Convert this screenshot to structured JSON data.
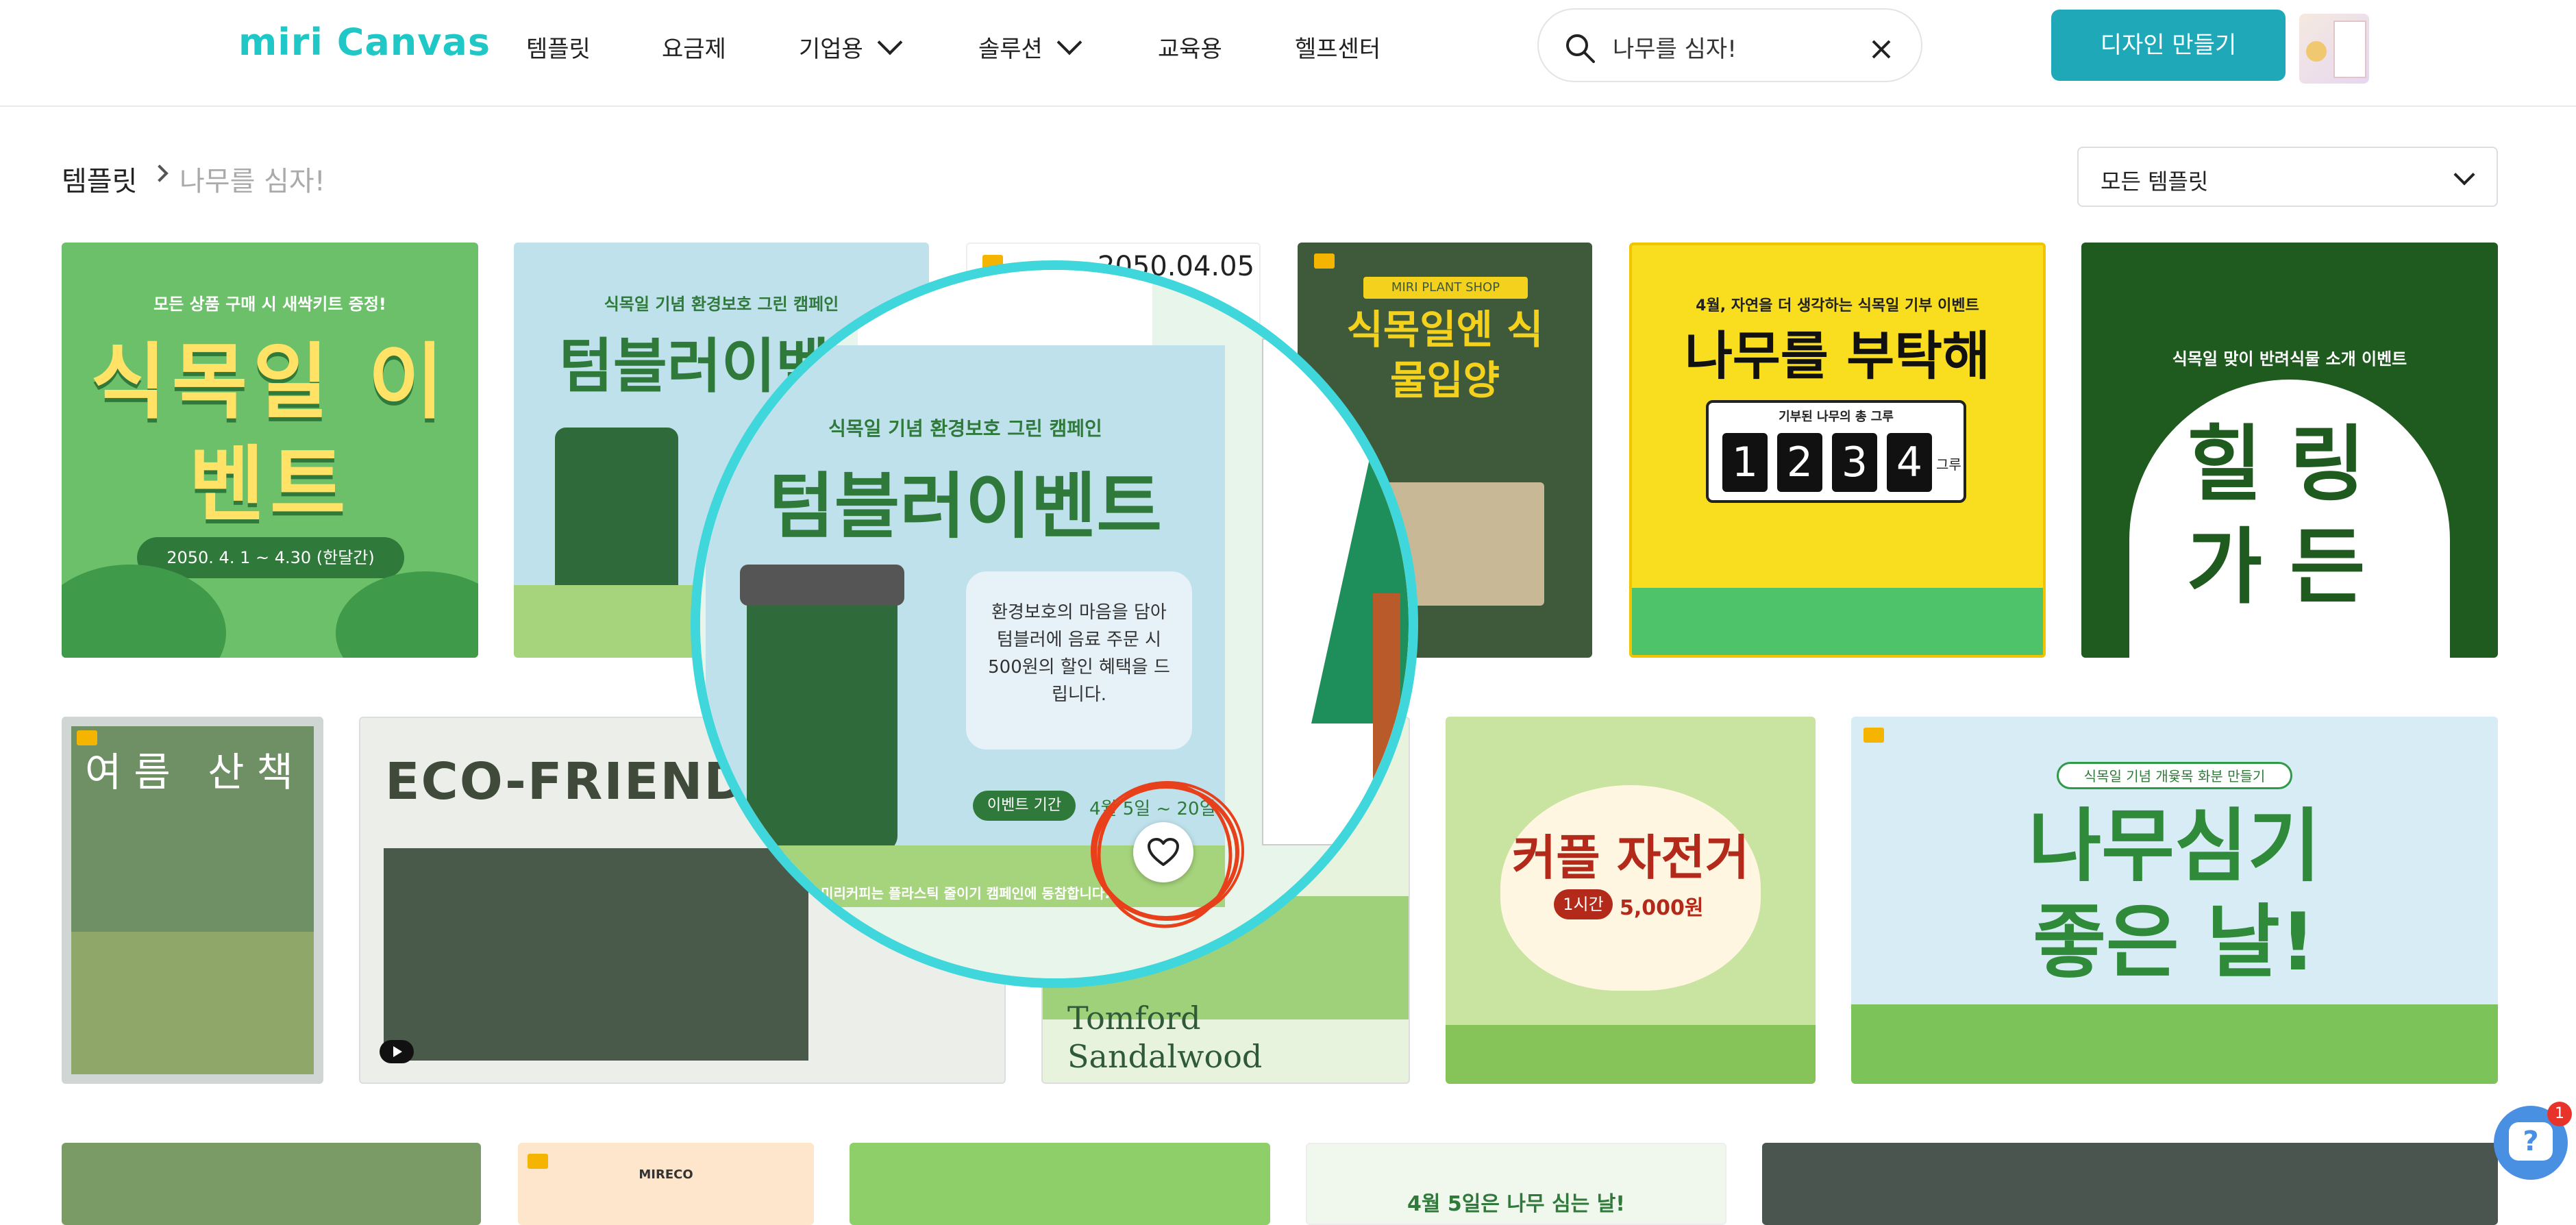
{
  "header": {
    "logo": "miri Canvas",
    "nav": [
      {
        "label": "템플릿"
      },
      {
        "label": "요금제"
      },
      {
        "label": "기업용",
        "has_dropdown": true
      },
      {
        "label": "솔루션",
        "has_dropdown": true
      },
      {
        "label": "교육용"
      },
      {
        "label": "헬프센터"
      }
    ],
    "search_value": "나무를 심자!",
    "make_button": "디자인 만들기"
  },
  "breadcrumb": {
    "root": "템플릿",
    "current": "나무를 심자!"
  },
  "filter": {
    "selected": "모든 템플릿"
  },
  "templates": {
    "row1": [
      {
        "title": "식목일 이벤트",
        "subtitle": "모든 상품 구매 시 새싹키트 증정!",
        "date": "2050. 4. 1 ~ 4.30 (한달간)"
      },
      {
        "title": "텀블러이벤트",
        "subtitle": "식목일 기념 환경보호 그린 캠페인"
      },
      {
        "title": "2050.04.05"
      },
      {
        "title": "식목일엔 식물입양",
        "badge": "MIRI PLANT SHOP"
      },
      {
        "title": "나무를 부탁해",
        "subtitle": "4월, 자연을 더 생각하는 식목일 기부 이벤트",
        "counter_label": "기부된 나무의 총 그루",
        "digits": [
          "1",
          "2",
          "3",
          "4"
        ],
        "unit": "그루"
      },
      {
        "title": "힐링 가든",
        "subtitle": "식목일 맞이 반려식물 소개 이벤트"
      }
    ],
    "row2": [
      {
        "title": "여름 산책"
      },
      {
        "title": "ECO-FRIENDLY PR"
      },
      {
        "title": "Tomford Sandalwood"
      },
      {
        "title": "커플 자전거",
        "price_label": "1시간",
        "price": "5,000원"
      },
      {
        "title": "나무심기 좋은 날!",
        "subtitle": "식목일 기념 개윷목 화분 만들기"
      }
    ],
    "row3": [
      {
        "title": ""
      },
      {
        "title": "MIRECO"
      },
      {
        "title": ""
      },
      {
        "title": "4월 5일은 나무 심는 날!"
      },
      {
        "title": ""
      }
    ]
  },
  "magnifier": {
    "title": "텀블러이벤트",
    "subtitle": "식목일 기념 환경보호 그린 캠페인",
    "body": "환경보호의 마음을 담아 텀블러에 음료 주문 시 500원의 할인 혜택을 드립니다.",
    "period_label": "이벤트 기간",
    "period": "4월 5일 ~ 20일",
    "footer": "미리커피는 플라스틱 줄이기 캠페인에 동참합니다."
  },
  "help": {
    "badge": "1"
  },
  "colors": {
    "brand": "#1fc7c7",
    "button": "#1fa8b8",
    "magnifier_border": "#3fd7db",
    "annotation_red": "#e8401a"
  }
}
